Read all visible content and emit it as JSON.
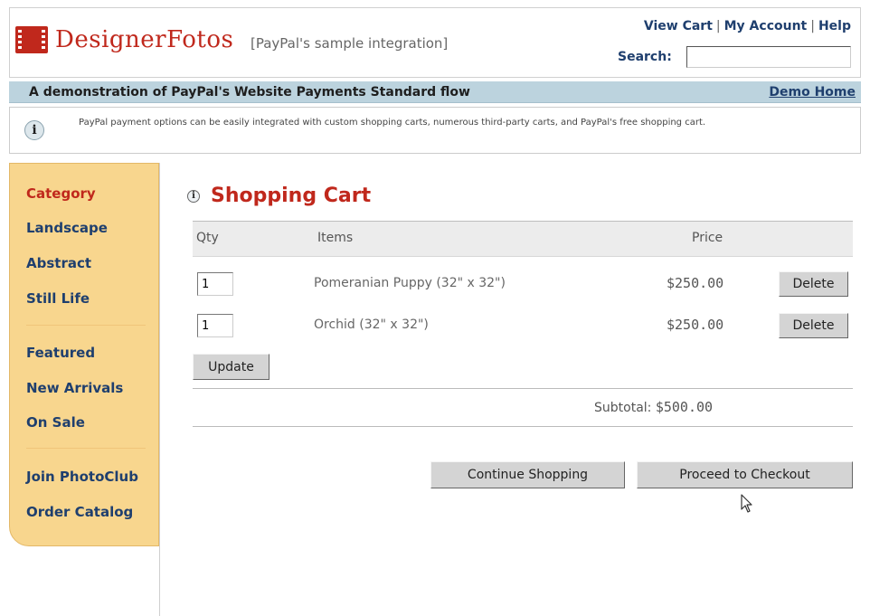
{
  "header": {
    "brand": "DesignerFotos",
    "subtitle": "[PayPal's sample integration]",
    "links": [
      "View Cart",
      "My Account",
      "Help"
    ],
    "search_label": "Search:",
    "search_value": ""
  },
  "banner": {
    "title": "A demonstration of PayPal's Website Payments Standard flow",
    "link": "Demo Home"
  },
  "info": {
    "text": "PayPal payment options can be easily integrated with custom shopping carts, numerous third-party carts, and PayPal's free shopping cart."
  },
  "sidebar": {
    "category": "Category",
    "group1": [
      "Landscape",
      "Abstract",
      "Still Life"
    ],
    "group2": [
      "Featured",
      "New Arrivals",
      "On Sale"
    ],
    "group3": [
      "Join PhotoClub",
      "Order Catalog"
    ]
  },
  "cart": {
    "title": "Shopping Cart",
    "columns": {
      "qty": "Qty",
      "items": "Items",
      "price": "Price"
    },
    "rows": [
      {
        "qty": "1",
        "item": "Pomeranian Puppy (32\" x 32\")",
        "price": "$250.00",
        "delete": "Delete"
      },
      {
        "qty": "1",
        "item": "Orchid (32\" x 32\")",
        "price": "$250.00",
        "delete": "Delete"
      }
    ],
    "update_label": "Update",
    "subtotal_label": "Subtotal:",
    "subtotal_value": "$500.00",
    "continue_label": "Continue Shopping",
    "checkout_label": "Proceed to Checkout"
  },
  "icons": {
    "logo": "film-strip-icon",
    "info": "info-icon",
    "cursor": "mouse-cursor-icon"
  },
  "colors": {
    "brand": "#c0281c",
    "link": "#1f3f6e",
    "banner_bg": "#bcd3de",
    "sidebar_bg": "#f8d68e"
  }
}
